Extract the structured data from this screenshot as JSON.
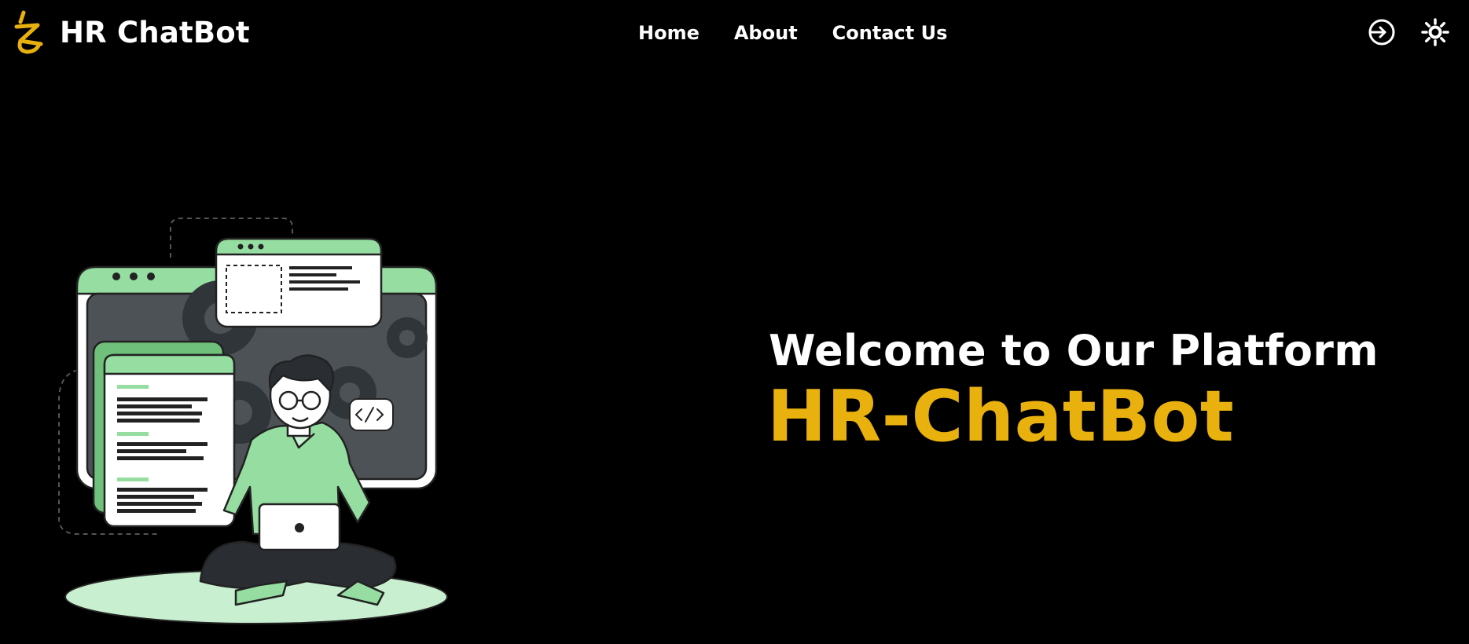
{
  "navbar": {
    "brand_name": "HR ChatBot",
    "links": [
      {
        "label": "Home"
      },
      {
        "label": "About"
      },
      {
        "label": "Contact Us"
      }
    ],
    "icons": {
      "login": "login-icon",
      "theme": "sun-icon"
    }
  },
  "hero": {
    "subtitle": "Welcome to Our Platform",
    "title": "HR-ChatBot",
    "illustration": "developer-with-laptop-illustration"
  },
  "colors": {
    "background": "#000000",
    "accent": "#E8B10E",
    "text": "#FFFFFF",
    "illustration_green": "#95DDA0"
  }
}
